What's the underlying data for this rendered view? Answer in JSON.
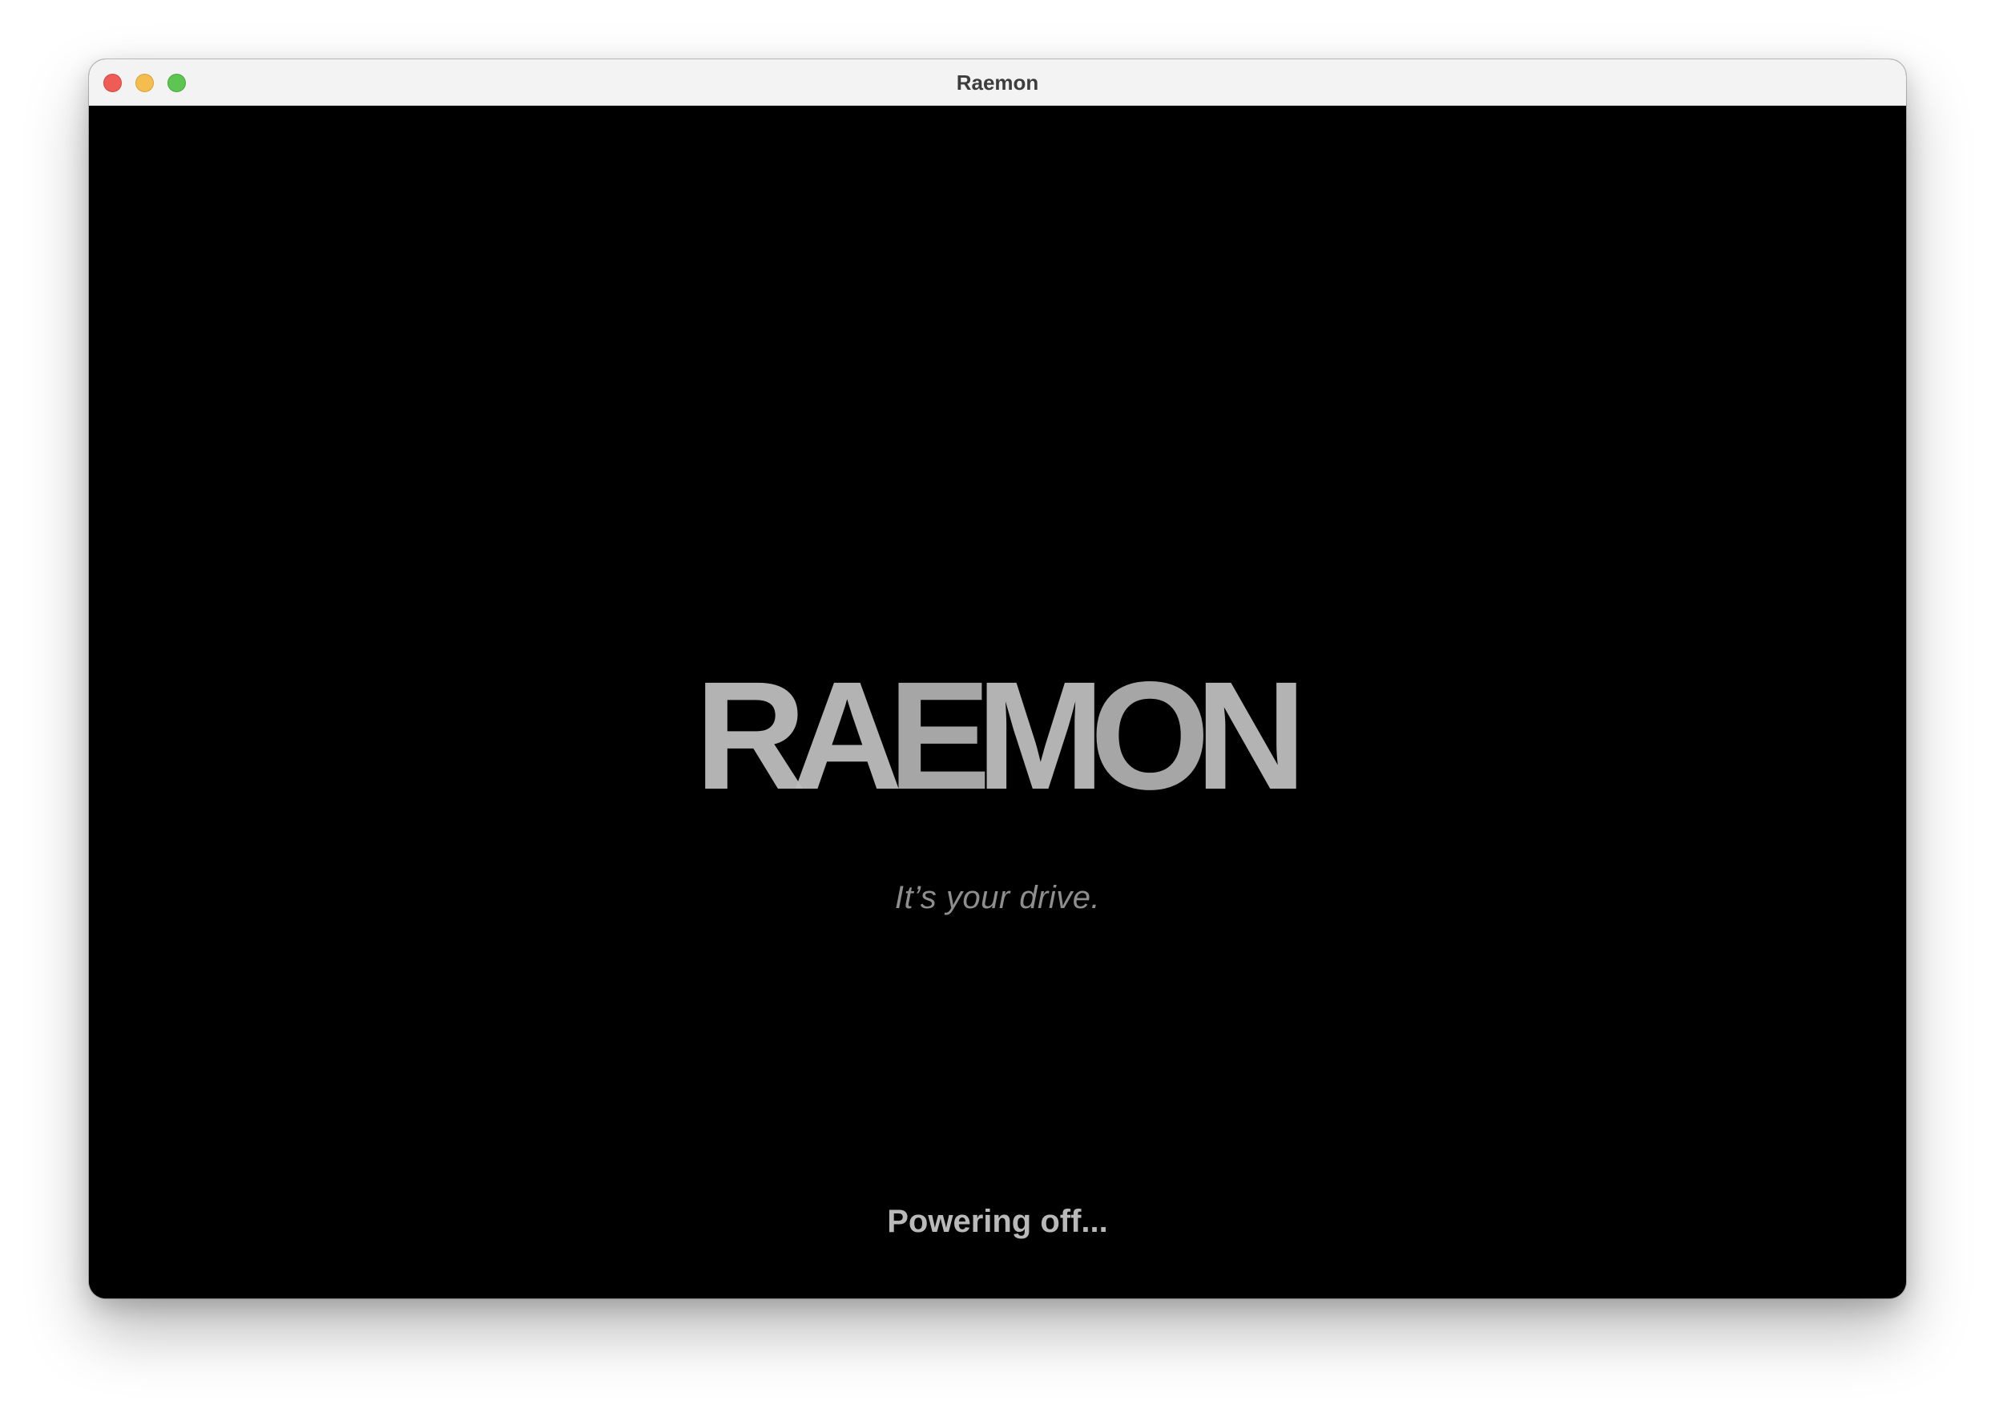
{
  "window": {
    "title": "Raemon"
  },
  "splash": {
    "logo_letters": [
      "R",
      "A",
      "E",
      "M",
      "O",
      "N"
    ],
    "tagline": "It’s your drive.",
    "status": "Powering off..."
  },
  "colors": {
    "titlebar_bg": "#f2f3f2",
    "content_bg": "#000000",
    "logo_color": "#bdbdbd",
    "tagline_color": "#8e8e8e",
    "status_color": "#b9b9b9",
    "close": "#ee5c55",
    "minimize": "#f5bd4f",
    "zoom": "#5ec553"
  },
  "icons": {
    "close": "close-traffic-light-icon",
    "minimize": "minimize-traffic-light-icon",
    "zoom": "zoom-traffic-light-icon"
  }
}
